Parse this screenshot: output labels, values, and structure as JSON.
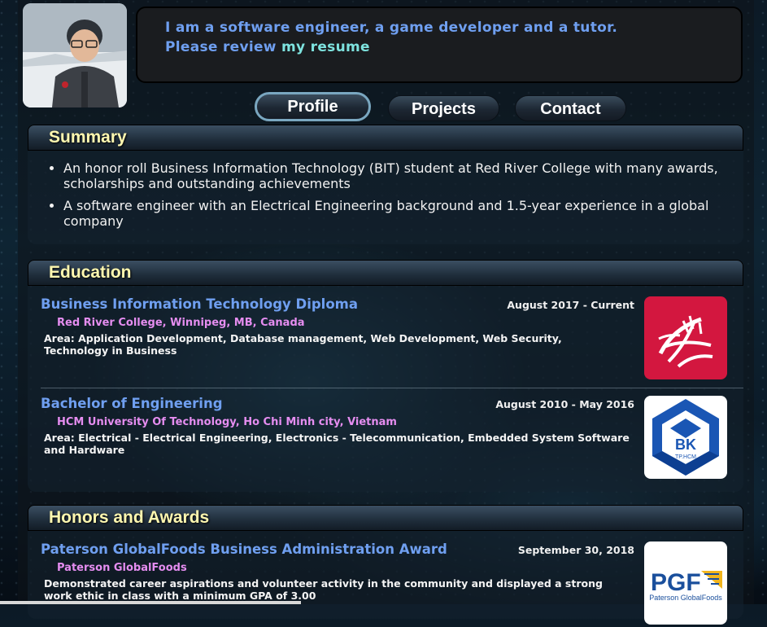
{
  "bio": {
    "line1": "I am a software engineer, a game developer and a tutor.",
    "line2_prefix": "Please review ",
    "resume_link": "my resume"
  },
  "nav": [
    {
      "label": "Profile",
      "active": true
    },
    {
      "label": "Projects",
      "active": false
    },
    {
      "label": "Contact",
      "active": false
    }
  ],
  "summary": {
    "heading": "Summary",
    "items": [
      "An honor roll Business Information Technology (BIT) student at Red River College with many awards, scholarships and outstanding achievements",
      "A software engineer with an Electrical Engineering background and 1.5-year experience in a global company"
    ]
  },
  "education": {
    "heading": "Education",
    "entries": [
      {
        "title": "Business Information Technology Diploma",
        "date": "August 2017 - Current",
        "org": "Red River College, Winnipeg, MB, Canada",
        "desc": "Area: Application Development, Database management, Web Development, Web Security, Technology in Business",
        "logo": "red-river-college-logo"
      },
      {
        "title": "Bachelor of Engineering",
        "date": "August 2010 - May 2016",
        "org": "HCM University Of Technology, Ho Chi Minh city, Vietnam",
        "desc": "Area: Electrical - Electrical Engineering, Electronics - Telecommunication, Embedded System Software and Hardware",
        "logo": "hcmut-bk-logo",
        "logo_text": "BK",
        "logo_subtext": "TP.HCM"
      }
    ]
  },
  "honors": {
    "heading": "Honors and Awards",
    "entries": [
      {
        "title": "Paterson GlobalFoods Business Administration Award",
        "date": "September 30, 2018",
        "org": "Paterson GlobalFoods",
        "desc": "Demonstrated career aspirations and volunteer activity in the community and displayed a strong work ethic in class with a minimum GPA of 3.00",
        "logo": "paterson-globalfoods-logo",
        "logo_text": "PGF",
        "logo_subtext": "Paterson GlobalFoods"
      }
    ]
  },
  "colors": {
    "accent_blue": "#6f9ff0",
    "heading_yellow": "#fff8b0",
    "org_pink": "#e58df0",
    "link_cyan": "#7ee3df"
  }
}
